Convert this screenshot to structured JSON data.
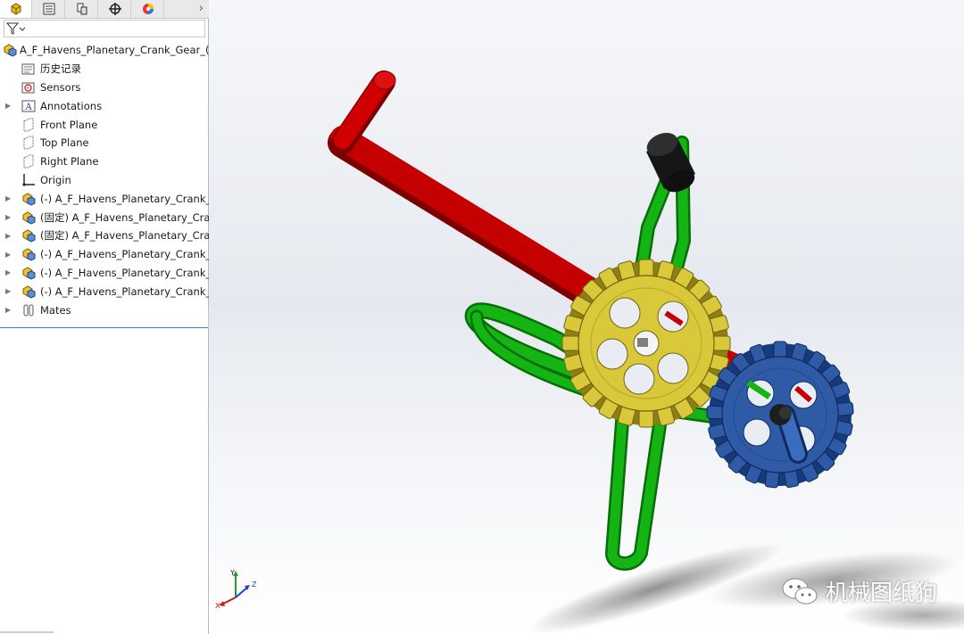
{
  "feature_manager": {
    "tabs": [
      {
        "icon": "feature-manager-tree-icon"
      },
      {
        "icon": "property-manager-icon"
      },
      {
        "icon": "configuration-manager-icon"
      },
      {
        "icon": "dimxpert-manager-icon"
      },
      {
        "icon": "display-manager-icon"
      }
    ],
    "more_tabs_glyph": "›",
    "tree": {
      "root_label": "A_F_Havens_Planetary_Crank_Gear_(as",
      "items": [
        {
          "label": "历史记录",
          "icon": "history-folder-icon"
        },
        {
          "label": "Sensors",
          "icon": "sensors-folder-icon"
        },
        {
          "label": "Annotations",
          "icon": "annotations-folder-icon"
        },
        {
          "label": "Front Plane",
          "icon": "plane-icon"
        },
        {
          "label": "Top Plane",
          "icon": "plane-icon"
        },
        {
          "label": "Right Plane",
          "icon": "plane-icon"
        },
        {
          "label": "Origin",
          "icon": "origin-icon"
        },
        {
          "label": "(-) A_F_Havens_Planetary_Crank_Gear",
          "icon": "part-icon"
        },
        {
          "label": "(固定) A_F_Havens_Planetary_Crank_Gear",
          "icon": "part-icon"
        },
        {
          "label": "(固定) A_F_Havens_Planetary_Crank_Gear",
          "icon": "part-icon"
        },
        {
          "label": "(-) A_F_Havens_Planetary_Crank_Gear",
          "icon": "part-icon"
        },
        {
          "label": "(-) A_F_Havens_Planetary_Crank_Gear",
          "icon": "part-icon"
        },
        {
          "label": "(-) A_F_Havens_Planetary_Crank_Gear",
          "icon": "part-icon"
        },
        {
          "label": "Mates",
          "icon": "mates-folder-icon"
        }
      ]
    }
  },
  "viewport": {
    "colors": {
      "crank": "#c40000",
      "frame": "#14b414",
      "sun_gear": "#d9c93a",
      "planet_gear": "#2e5aa6",
      "knob": "#1e1e1e"
    }
  },
  "triad": {
    "x": "X",
    "y": "Y",
    "z": "Z"
  },
  "watermark": {
    "text": "机械图纸狗",
    "icon": "wechat-icon"
  }
}
